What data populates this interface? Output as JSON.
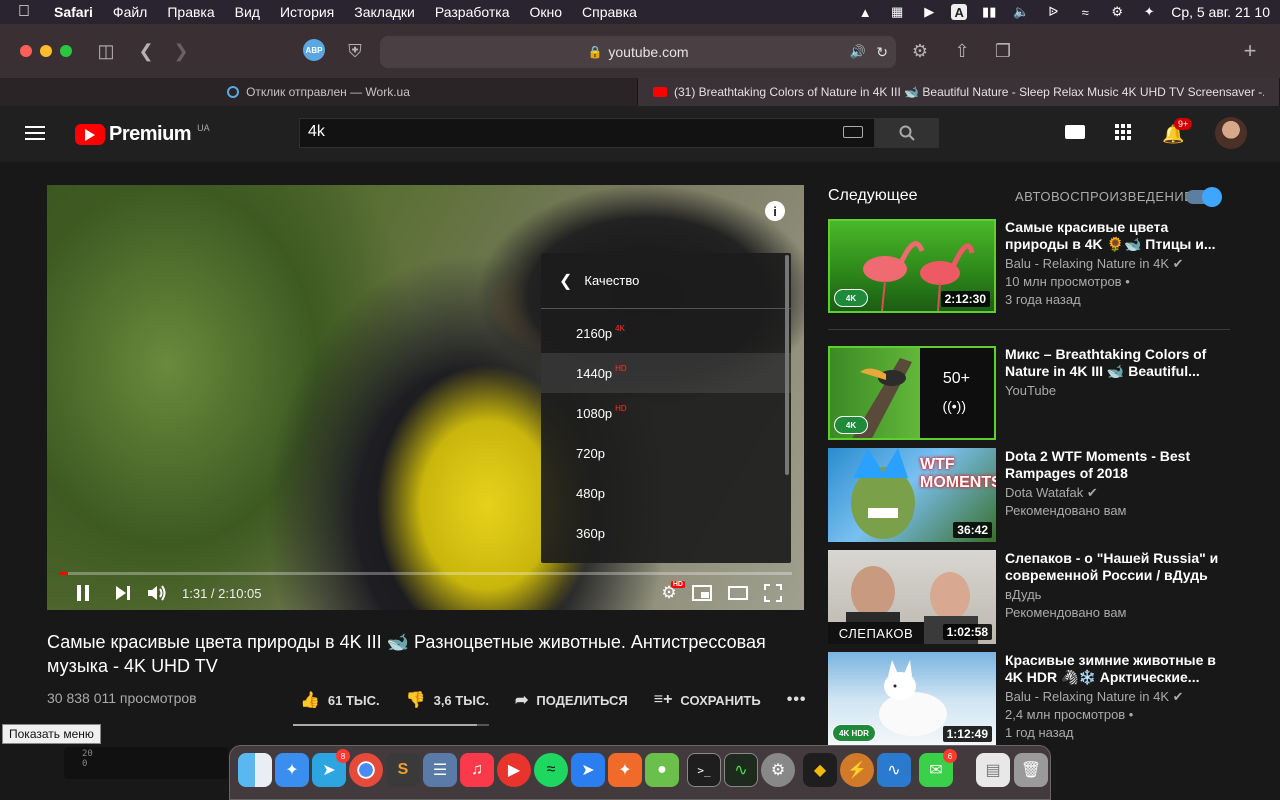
{
  "menubar": {
    "app": "Safari",
    "items": [
      "Файл",
      "Правка",
      "Вид",
      "История",
      "Закладки",
      "Разработка",
      "Окно",
      "Справка"
    ],
    "clock": "Ср, 5 авг.  21 10",
    "keyboard_layout": "A"
  },
  "browser": {
    "abp_label": "ABP",
    "url": "youtube.com",
    "tabs": [
      {
        "label": "Отклик отправлен — Work.ua",
        "active": false
      },
      {
        "label": "(31) Breathtaking Colors of Nature in 4K III 🐋 Beautiful Nature - Sleep Relax Music 4K UHD TV Screensaver -...",
        "active": true
      }
    ]
  },
  "youtube": {
    "logo_text": "Premium",
    "region": "UA",
    "search_value": "4k",
    "notifications": "9+"
  },
  "player": {
    "time_current": "1:31",
    "time_total": "2:10:05",
    "time_text": "1:31 / 2:10:05",
    "progress_fraction": 0.012,
    "quality_menu": {
      "title": "Качество",
      "options": [
        {
          "label": "2160p",
          "badge": "4K"
        },
        {
          "label": "1440p",
          "badge": "HD"
        },
        {
          "label": "1080p",
          "badge": "HD"
        },
        {
          "label": "720p",
          "badge": ""
        },
        {
          "label": "480p",
          "badge": ""
        },
        {
          "label": "360p",
          "badge": ""
        }
      ],
      "highlighted_index": 1
    },
    "settings_badge": "HD"
  },
  "video": {
    "title": "Самые красивые цвета природы в 4K III 🐋 Разноцветные животные. Антистрессовая музыка - 4K UHD TV",
    "views": "30 838 011 просмотров",
    "likes": "61 ТЫС.",
    "dislikes": "3,6 ТЫС.",
    "share": "ПОДЕЛИТЬСЯ",
    "save": "СОХРАНИТЬ",
    "like_ratio": 0.94
  },
  "sidebar": {
    "next_label": "Следующее",
    "autoplay_label": "АВТОВОСПРОИЗВЕДЕНИЕ",
    "autoplay_on": true,
    "items": [
      {
        "title": "Самые красивые цвета природы в 4K 🌻🐋 Птицы и...",
        "channel": "Balu - Relaxing Nature in 4K",
        "views": "10 млн просмотров •",
        "age": "3 года назад",
        "duration": "2:12:30",
        "badge": "4K"
      },
      {
        "title": "Микс – Breathtaking Colors of Nature in 4K III 🐋 Beautiful...",
        "channel": "YouTube",
        "views": "",
        "age": "",
        "duration": "",
        "badge": "4K",
        "mix_count": "50+"
      },
      {
        "title": "Dota 2 WTF Moments - Best Rampages of 2018",
        "channel": "Dota Watafak",
        "views": "Рекомендовано вам",
        "age": "",
        "duration": "36:42",
        "badge": "",
        "thumb_text": "WTF MOMENTS"
      },
      {
        "title": "Слепаков - о \"Нашей Russia\" и современной России / вДудь",
        "channel": "вДудь",
        "views": "Рекомендовано вам",
        "age": "",
        "duration": "1:02:58",
        "badge": "",
        "thumb_text": "СЛЕПАКОВ"
      },
      {
        "title": "Красивые зимние животные в 4K HDR 🦓❄️ Арктические...",
        "channel": "Balu - Relaxing Nature in 4K",
        "views": "2,4 млн просмотров •",
        "age": "1 год назад",
        "duration": "1:12:49",
        "badge": "4K HDR"
      }
    ]
  },
  "tooltip": "Показать меню",
  "dock": {
    "badges": {
      "telegram": "8",
      "messages": "6"
    }
  },
  "terminal_mini": [
    "20",
    "0"
  ]
}
